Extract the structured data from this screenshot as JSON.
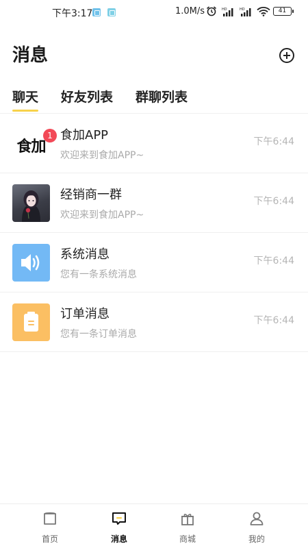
{
  "status_bar": {
    "time": "下午3:17",
    "network_speed": "1.0M/s",
    "battery": "41",
    "icons": [
      "app-notification-icon",
      "app-notification-icon",
      "alarm-icon",
      "hd-signal-icon",
      "hd-signal-icon",
      "wifi-icon",
      "battery-icon"
    ]
  },
  "header": {
    "title": "消息",
    "add_icon": "plus-circle-icon"
  },
  "tabs": [
    {
      "label": "聊天",
      "active": true
    },
    {
      "label": "好友列表",
      "active": false
    },
    {
      "label": "群聊列表",
      "active": false
    }
  ],
  "colors": {
    "accent": "#f8d24b",
    "badge": "#f24957",
    "system_avatar": "#73b9f5",
    "order_avatar": "#fbbf63"
  },
  "chats": [
    {
      "name": "食加APP",
      "preview": "欢迎来到食加APP~",
      "time": "下午6:44",
      "badge": "1",
      "avatar_text": "食加",
      "avatar": "app-logo"
    },
    {
      "name": "经销商一群",
      "preview": "欢迎来到食加APP~",
      "time": "下午6:44",
      "avatar": "portrait-photo"
    },
    {
      "name": "系统消息",
      "preview": "您有一条系统消息",
      "time": "下午6:44",
      "avatar": "speaker-icon"
    },
    {
      "name": "订单消息",
      "preview": "您有一条订单消息",
      "time": "下午6:44",
      "avatar": "clipboard-icon"
    }
  ],
  "bottom_nav": [
    {
      "label": "首页",
      "icon": "home-icon",
      "active": false
    },
    {
      "label": "消息",
      "icon": "message-icon",
      "active": true
    },
    {
      "label": "商城",
      "icon": "gift-icon",
      "active": false
    },
    {
      "label": "我的",
      "icon": "user-icon",
      "active": false
    }
  ]
}
